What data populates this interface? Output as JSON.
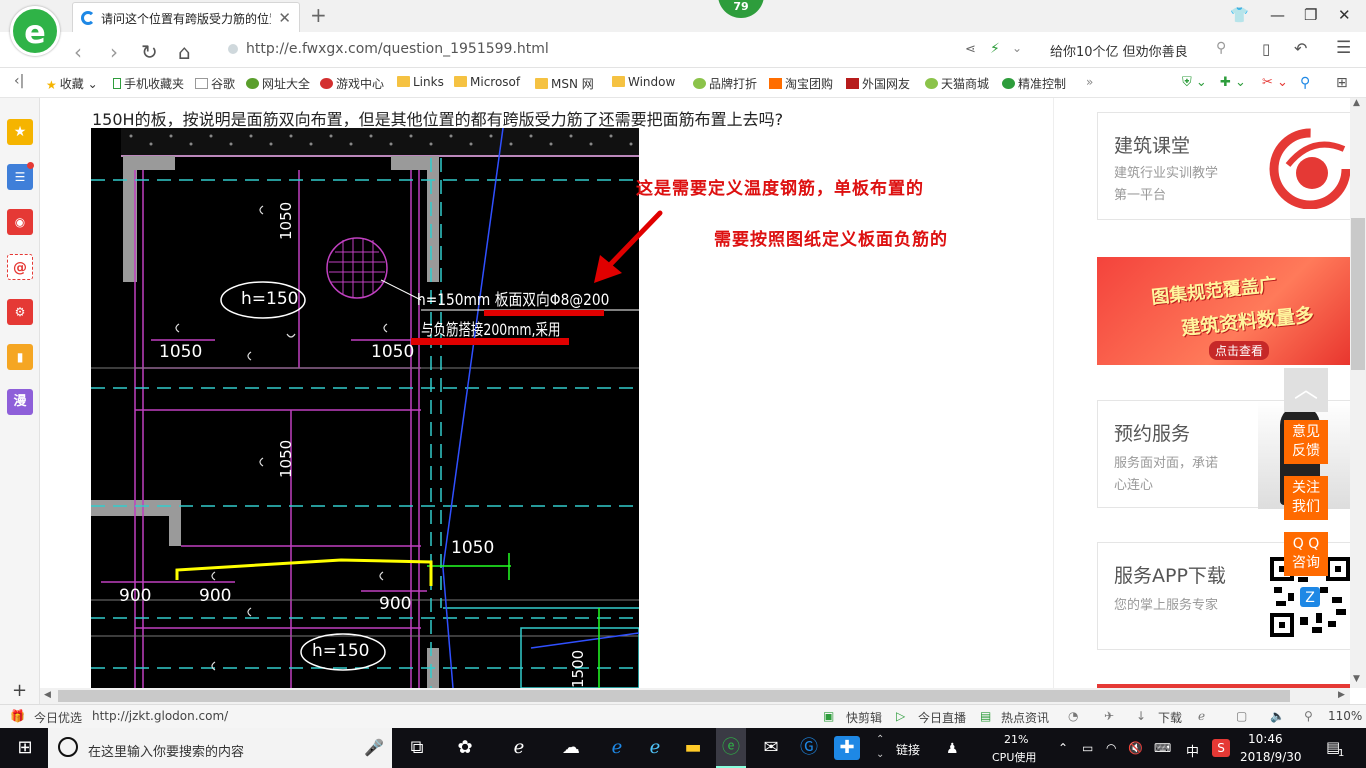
{
  "browser": {
    "logo_letter": "e",
    "tab_title": "请问这个位置有跨版受力筋的位置",
    "new_tab_symbol": "+",
    "notification_count": "79",
    "url": "http://e.fwxgx.com/question_1951599.html",
    "search_text": "给你10个亿 但劝你善良",
    "zoom": "110%"
  },
  "bookmarks": [
    "收藏",
    "手机收藏夹",
    "谷歌",
    "网址大全",
    "游戏中心",
    "Links",
    "Microsof",
    "MSN 网",
    "Window",
    "品牌打折",
    "淘宝团购",
    "外国网友",
    "天猫商城",
    "精准控制"
  ],
  "sidebar": {
    "comic_label": "漫"
  },
  "question": {
    "text": "150H的板，按说明是面筋双向布置，但是其他位置的都有跨版受力筋了还需要把面筋布置上去吗?",
    "annotation_1": "这是需要定义温度钢筋，单板布置的",
    "annotation_2": "需要按照图纸定义板面负筋的"
  },
  "cad": {
    "dims": [
      "1050",
      "1050",
      "1050",
      "1050",
      "1050",
      "900",
      "900",
      "900",
      "1500"
    ],
    "h150": "h=150",
    "note_line1": "h=150mm 板面双向Φ8@200",
    "note_line2": "与负筋搭接200mm,采用"
  },
  "right_column": {
    "card1": {
      "title": "建筑课堂",
      "subtitle": "建筑行业实训教学第一平台"
    },
    "banner": {
      "line1": "图集规范覆盖广",
      "line2": "建筑资料数量多",
      "cta": "点击查看"
    },
    "card2": {
      "title": "预约服务",
      "subtitle": "服务面对面，承诺心连心"
    },
    "card3": {
      "title": "服务APP下载",
      "subtitle": "您的掌上服务专家"
    },
    "float_buttons": [
      "意见\n反馈",
      "关注\n我们",
      "Q Q\n咨询"
    ]
  },
  "statusbar": {
    "left_label": "今日优选",
    "link": "http://jzkt.glodon.com/",
    "items": [
      "快剪辑",
      "今日直播",
      "热点资讯",
      "下载"
    ]
  },
  "taskbar": {
    "search_placeholder": "在这里输入你要搜索的内容",
    "link_label": "链接",
    "cpu_percent": "21%",
    "cpu_label": "CPU使用",
    "ime": "中",
    "time": "10:46",
    "date": "2018/9/30",
    "notification_count": "1"
  },
  "colors": {
    "accent_green": "#2fb347",
    "annotation_red": "#dd1111",
    "float_orange": "#ff6a00"
  }
}
